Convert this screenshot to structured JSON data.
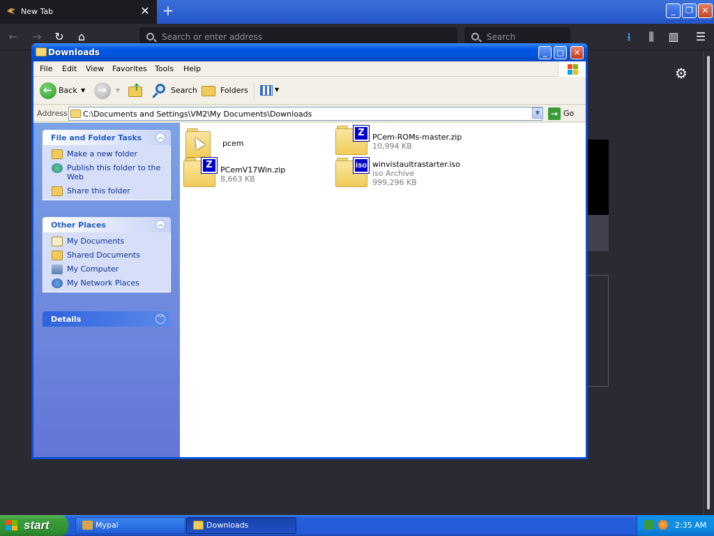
{
  "browser": {
    "tab_title": "New Tab",
    "url_placeholder": "Search or enter address",
    "search_placeholder": "Search"
  },
  "window": {
    "title": "Downloads",
    "menu": [
      "File",
      "Edit",
      "View",
      "Favorites",
      "Tools",
      "Help"
    ],
    "toolbar": {
      "back": "Back",
      "search": "Search",
      "folders": "Folders"
    },
    "address": {
      "label": "Address",
      "path": "C:\\Documents and Settings\\VM2\\My Documents\\Downloads",
      "go": "Go"
    }
  },
  "task_pane": {
    "file_tasks": {
      "title": "File and Folder Tasks",
      "items": [
        "Make a new folder",
        "Publish this folder to the Web",
        "Share this folder"
      ]
    },
    "other_places": {
      "title": "Other Places",
      "items": [
        "My Documents",
        "Shared Documents",
        "My Computer",
        "My Network Places"
      ]
    },
    "details": {
      "title": "Details"
    }
  },
  "files": [
    {
      "name": "pcem",
      "type": "folder"
    },
    {
      "name": "PCem-ROMs-master.zip",
      "size": "10,994 KB",
      "badge": "Z"
    },
    {
      "name": "PCemV17Win.zip",
      "size": "8,663 KB",
      "badge": "Z"
    },
    {
      "name": "winvistaultrastarter.iso",
      "kind": "iso Archive",
      "size": "999,296 KB",
      "badge": "iso"
    }
  ],
  "taskbar": {
    "start": "start",
    "tasks": [
      "Mypal",
      "Downloads"
    ],
    "clock": "2:35 AM"
  },
  "colors": {
    "xp_blue": "#0054e3",
    "start_green": "#3c9e3c",
    "link_blue": "#0c2f98"
  }
}
